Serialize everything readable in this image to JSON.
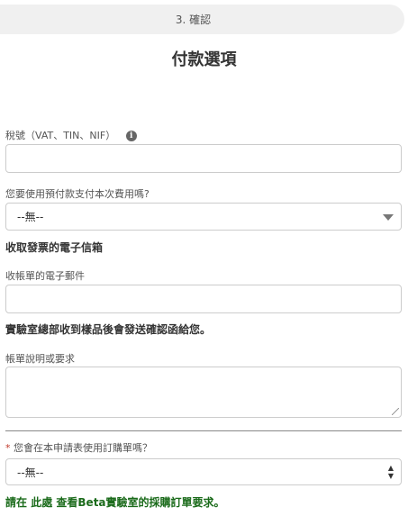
{
  "step": {
    "label": "3. 確認"
  },
  "page": {
    "title": "付款選項"
  },
  "tax_id": {
    "label": "稅號（VAT、TIN、NIF）",
    "value": ""
  },
  "prepay": {
    "label": "您要使用預付款支付本次費用嗎?",
    "selected": "--無--"
  },
  "invoice_email_section": {
    "heading": "收取發票的電子信箱"
  },
  "billing_email": {
    "label": "收帳單的電子郵件",
    "value": ""
  },
  "confirm_notice": {
    "text": "實驗室總部收到樣品後會發送確認函給您。"
  },
  "billing_notes": {
    "label": "帳單說明或要求",
    "value": ""
  },
  "purchase_order": {
    "required_mark": "*",
    "label": "您會在本申請表使用訂購單嗎？",
    "selected": "--無--"
  },
  "po_note": {
    "prefix": "請在",
    "link": "此處",
    "suffix": "查看Beta實驗室的採購訂單要求。"
  },
  "colors": {
    "link_green": "#1b6b1b",
    "required_red": "#c0392b"
  }
}
